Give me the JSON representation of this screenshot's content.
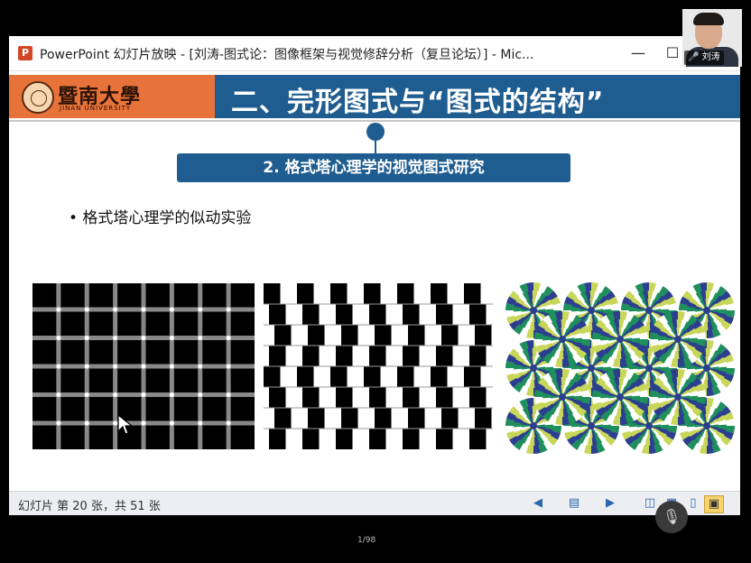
{
  "window": {
    "icon_letter": "P",
    "title": "PowerPoint 幻灯片放映 - [刘涛-图式论：图像框架与视觉修辞分析（复旦论坛）] - Mic...",
    "minimize": "—",
    "maximize": "☐",
    "close": "✕"
  },
  "slide": {
    "logo_cn": "暨南大學",
    "logo_en": "JINAN UNIVERSITY",
    "header_title": "二、完形图式与“图式的结构”",
    "subtitle": "2. 格式塔心理学的视觉图式研究",
    "bullet": "• 格式塔心理学的似动实验"
  },
  "statusbar": {
    "slide_counter": "幻灯片 第 20 张，共 51 张",
    "prev": "◀",
    "menu": "▤",
    "next": "▶",
    "view_normal": "◫",
    "view_sorter": "▦",
    "view_reading": "▯",
    "view_slideshow": "▣"
  },
  "video": {
    "participant": "🎤 刘涛",
    "page_indicator": "1/98",
    "mic": "🎙"
  },
  "colors": {
    "header_blue": "#1f5d90",
    "logo_orange": "#e8733a",
    "grid_line": "#888888",
    "snake_a": "#1f8f5c",
    "snake_b": "#2c3f8f",
    "snake_c": "#c8d65a"
  }
}
